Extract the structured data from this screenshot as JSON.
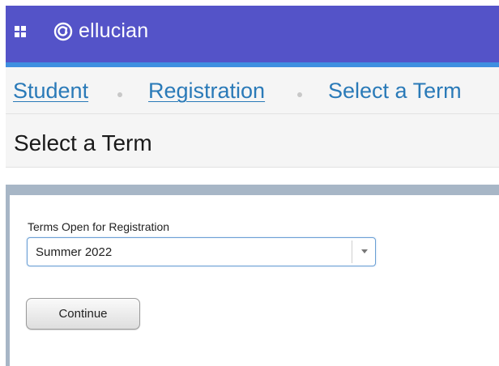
{
  "header": {
    "apps_icon": "grid-icon",
    "logo_icon": "ellucian-logo-icon",
    "brand_name": "ellucian",
    "colors": {
      "header_bg": "#5453c8",
      "header_stripe": "#3f8fe0"
    }
  },
  "breadcrumb": {
    "items": [
      {
        "label": "Student",
        "link": true
      },
      {
        "label": "Registration",
        "link": true
      },
      {
        "label": "Select a Term",
        "link": false
      }
    ],
    "link_color": "#2a7ab8"
  },
  "page": {
    "title": "Select a Term"
  },
  "form": {
    "terms_label": "Terms Open for Registration",
    "selected_term": "Summer 2022",
    "continue_label": "Continue"
  }
}
